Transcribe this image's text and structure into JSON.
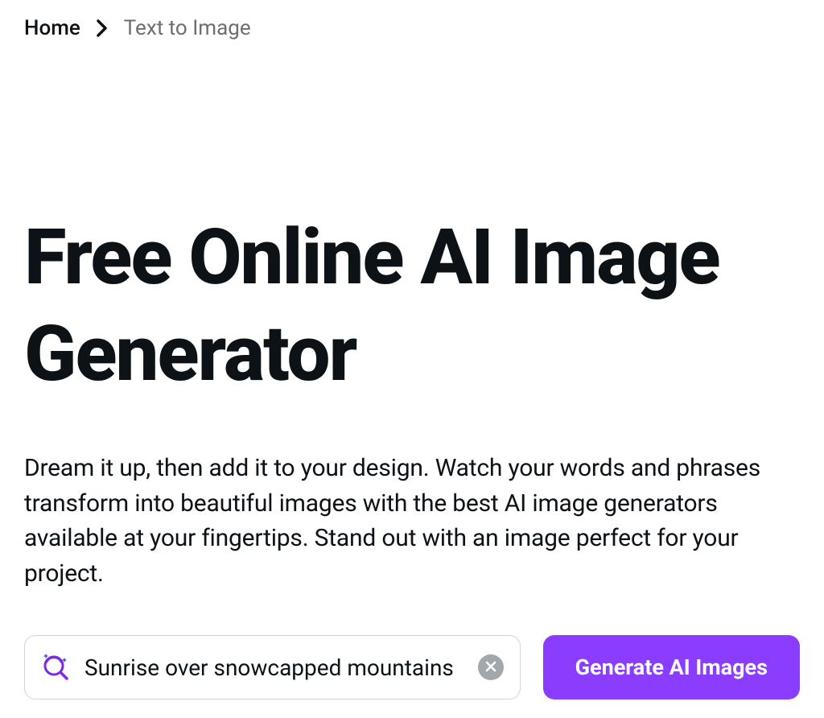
{
  "breadcrumb": {
    "home": "Home",
    "current": "Text to Image"
  },
  "hero": {
    "title": "Free Online AI Image Generator",
    "description": "Dream it up, then add it to your design. Watch your words and phrases transform into beautiful images with the best AI image generators available at your fingertips. Stand out with an image perfect for your project."
  },
  "prompt": {
    "value": "Sunrise over snowcapped mountains",
    "generate_label": "Generate AI Images"
  }
}
